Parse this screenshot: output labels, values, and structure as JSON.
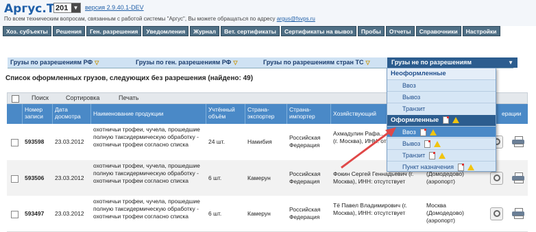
{
  "header": {
    "logo_main": "Аргус.",
    "logo_ty": "ТУ",
    "year": "201",
    "version": "версия 2.9.40.1-DEV",
    "support_text": "По всем техническим вопросам, связанным с работой системы \"Аргус\", Вы можете обращаться по адресу",
    "support_email": "argus@fsvps.ru"
  },
  "nav": [
    "Хоз. субъекты",
    "Решения",
    "Ген. разрешения",
    "Уведомления",
    "Журнал",
    "Вет. сертификаты",
    "Сертификаты на вывоз",
    "Пробы",
    "Отчеты",
    "Справочники",
    "Настройки"
  ],
  "tabs": [
    {
      "label": "Грузы по разрешениям РФ"
    },
    {
      "label": "Грузы по ген. разрешениям РФ"
    },
    {
      "label": "Грузы по разрешениям стран ТС"
    },
    {
      "label": "Грузы не по разрешениям"
    }
  ],
  "list_title": "Список оформленных грузов, следующих без разрешения (найдено: 49)",
  "toolbar": {
    "search": "Поиск",
    "sort": "Сортировка",
    "print": "Печать"
  },
  "columns": {
    "number": "Номер записи",
    "date": "Дата досмотра",
    "product": "Наименование продукции",
    "volume": "Учтённый объём",
    "exporter": "Страна-экспортер",
    "importer": "Страна-импортер",
    "entity": "Хозяйствующий",
    "tail": "ерации"
  },
  "rows": [
    {
      "number": "593598",
      "date": "23.03.2012",
      "product": "охотничьи трофеи, чучела, прошедшие полную таксидермическую обработку - охотничьи трофеи согласно списка",
      "volume": "24 шт.",
      "exporter": "Намибия",
      "importer": "Российская Федерация",
      "entity": "Ахмадулин Рафа... Адгамович (г. Москва), ИНН: отсутствует",
      "place": ""
    },
    {
      "number": "593506",
      "date": "23.03.2012",
      "product": "охотничьи трофеи, чучела, прошедшие полную таксидермическую обработку - охотничьи трофеи согласно списка",
      "volume": "6 шт.",
      "exporter": "Камерун",
      "importer": "Российская Федерация",
      "entity": "Фокин Сергей Геннадьевич (г. Москва), ИНН: отсутствует",
      "place": "(Домодедово) (аэропорт)"
    },
    {
      "number": "593497",
      "date": "23.03.2012",
      "product": "охотничьи трофеи, чучела, прошедшие полную таксидермическую обработку - охотничьи трофеи согласно списка",
      "volume": "6 шт.",
      "exporter": "Камерун",
      "importer": "Российская Федерация",
      "entity": "Тё Павел Владимирович (г. Москва), ИНН: отсутствует",
      "place": "Москва (Домодедово) (аэропорт)"
    }
  ],
  "dropdown": {
    "group1": "Неоформленные",
    "group1_items": [
      "Ввоз",
      "Вывоз",
      "Транзит"
    ],
    "group2": "Оформленные",
    "group2_items": [
      "Ввоз",
      "Вывоз",
      "Транзит",
      "Пункт назначения"
    ]
  },
  "colors": {
    "accent": "#4a89c7",
    "nav": "#4f6f85",
    "active_tab": "#2c5d8f",
    "arrow": "#e04848"
  }
}
